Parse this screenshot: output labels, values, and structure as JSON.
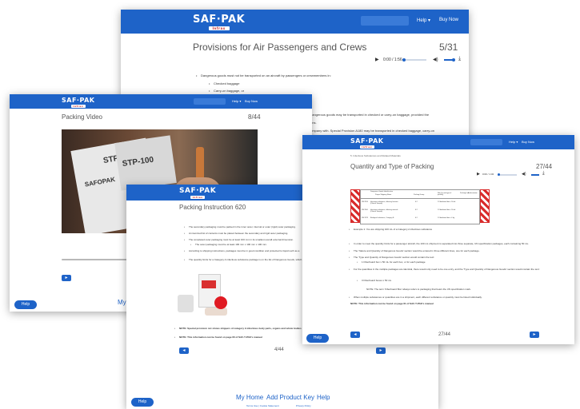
{
  "brand": {
    "logo": "SAF·PAK",
    "logo_sub": "Infrax"
  },
  "colors": {
    "accent": "#1e63c8",
    "text": "#555555"
  },
  "win1": {
    "nav": [
      "Help ▾",
      "Buy Now"
    ],
    "title": "Provisions for Air Passengers and Crews",
    "page": "5/31",
    "audio_time": "0:00 / 1:56",
    "bullets": [
      "Dangerous goods must not be transported on an aircraft by passengers or crewmembers in:",
      "Checked baggage",
      "Carry-on baggage, or"
    ],
    "snippets": [
      "dangerous goods may be transported in checked or carry-on baggage, provided the",
      "ons.",
      "ompany with. Special Provision A180 may be transported in checked baggage, carry-on"
    ]
  },
  "win2": {
    "nav": [
      "Help ▾",
      "Buy Now"
    ],
    "title": "Packing Video",
    "page": "8/44",
    "video_labels": [
      "STP-100",
      "STP-100",
      "SAFOPAK"
    ],
    "help": "Help",
    "footer": "My H"
  },
  "win3": {
    "nav": [
      "Help ▾",
      "Buy Now"
    ],
    "title": "Packing Instruction 620",
    "page": "4/44",
    "bullets": [
      "The secondary packaging must be packed in the inner outer, internal or outer (rigid) outer packaging.",
      "An itemized list of contents must be placed between the secondary and rigid outer packaging.",
      "The completed outer packaging must be at least 100 mm in its smallest overall external dimension.",
      "The outer packaging must be at least 100 mm x 100 mm x 100 mm.",
      "According to shipping instructions, packages must be in good condition and protected to liquid such as a",
      "The quantity limits for a Category A infectious substance package is on the list of Dangerous Goods, which"
    ],
    "note1": "NOTE: Special provision not shows shippers of category A infectious body parts, organs and whole bodies",
    "note2": "NOTE: This information can be found on page 60 of SAF-T-PAK's manual",
    "help": "Help",
    "footer_links": [
      "My Home",
      "Add Product Key",
      "Help"
    ],
    "footer_small": [
      "Terms Use | Cookie Statement",
      "Privacy Policy"
    ]
  },
  "win4": {
    "nav": [
      "Help ▾",
      "Buy Now"
    ],
    "breadcrumb": "5. Infectious Substances and Related Materials",
    "title": "Quantity and Type of Packing",
    "page": "27/44",
    "audio_time": "0:00 / 1:32",
    "table_headers": [
      "Dangerous Goods Identification",
      "Proper Shipping Name",
      "Packing Group",
      "Net Qty and type of packing",
      "Packing Inst",
      "Authorization"
    ],
    "table_rows": [
      [
        "UN 2814",
        "Infectious substance, affecting humans (Clinical Sample)",
        "6.2",
        "1 Fiberboard box x 50 mL"
      ],
      [
        "UN 2900",
        "Infectious substance, affecting animals (Clinical Sample)",
        "6.2",
        "1 Fiberboard box x 50 mL"
      ],
      [
        "UN 3373",
        "Biological substance, Category B",
        "6.2",
        "1 Fiberboard box x 4 kg"
      ]
    ],
    "bullets": [
      "Example 1: You are shipping 100 mL of a Category A infectious substance",
      "In order to meet the quantity limits for a passenger aircraft, the 100 mL shipment is separated into three separate, UN specification packages, each containing 50 mL.",
      "The 'Nature and Quantity of Dangerous Goods' section would be entered in three different lines, one for each package.",
      "The 'Type and Quantity of Dangerous Goods' section would contain the text:",
      "1 Fiberboard box x 50 mL for each box, or for each package",
      "For the quantities in the multiple packages are identical, there would only need to be one entry, and the 'Type and Quantity of Dangerous Goods' section would contain the text:",
      "3 Fiberboard boxes x 50 mL",
      "NOTE: The term 'Fiberboard Box' always refers to packaging that bears the UN specification mark.",
      "When multiple substances or quantities are in a shipment, each different substance or quantity must be listed individually."
    ],
    "note": "NOTE: This information can be found on page 61 of SAF-T-PAK's manual",
    "help": "Help"
  }
}
